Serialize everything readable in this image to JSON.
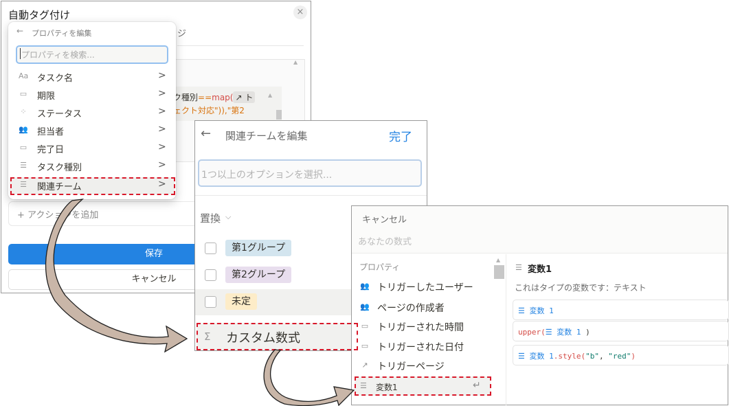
{
  "panel1": {
    "title": "自動タグ付け",
    "close_glyph": "×",
    "tab_partial": "ジ",
    "code_line1": {
      "prefix": "スク種別",
      "op": "==",
      "fn": "map(",
      "chip": "↗ ト"
    },
    "code_line2": "ジェクト対応\")),\"第2",
    "action_label": "+ アクションを追加",
    "save_label": "保存",
    "cancel_label": "キャンセル"
  },
  "dropdown": {
    "back_glyph": "←",
    "header": "プロパティを編集",
    "search_placeholder": "プロパティを検索...",
    "chevron": ">",
    "items": [
      {
        "icon": "Aa",
        "icon_name": "text-icon",
        "label": "タスク名"
      },
      {
        "icon": "▭",
        "icon_name": "calendar-icon",
        "label": "期限"
      },
      {
        "icon": "⁘",
        "icon_name": "status-icon",
        "label": "ステータス"
      },
      {
        "icon": "👥",
        "icon_name": "people-icon",
        "label": "担当者"
      },
      {
        "icon": "▭",
        "icon_name": "calendar-icon",
        "label": "完了日"
      },
      {
        "icon": "☰",
        "icon_name": "list-icon",
        "label": "タスク種別"
      },
      {
        "icon": "☰",
        "icon_name": "list-icon",
        "label": "関連チーム"
      }
    ]
  },
  "panel2": {
    "back_glyph": "←",
    "title": "関連チームを編集",
    "done_label": "完了",
    "input_placeholder": "1つ以上のオプションを選択...",
    "replace_label": "置換",
    "replace_chevron": "⌵",
    "options": [
      {
        "label": "第1グループ",
        "color": "#d3e5ef"
      },
      {
        "label": "第2グループ",
        "color": "#e8deee"
      },
      {
        "label": "未定",
        "color": "#fdecc8"
      }
    ],
    "formula_icon": "Σ",
    "formula_label": "カスタム数式"
  },
  "panel3": {
    "cancel_label": "キャンセル",
    "formula_placeholder": "あなたの数式",
    "properties_header": "プロパティ",
    "properties": [
      {
        "icon": "👥",
        "icon_name": "people-icon",
        "label": "トリガーしたユーザー"
      },
      {
        "icon": "👥",
        "icon_name": "people-icon",
        "label": "ページの作成者"
      },
      {
        "icon": "▭",
        "icon_name": "calendar-icon",
        "label": "トリガーされた時間"
      },
      {
        "icon": "▭",
        "icon_name": "calendar-icon",
        "label": "トリガーされた日付"
      },
      {
        "icon": "↗",
        "icon_name": "arrow-icon",
        "label": "トリガーページ"
      }
    ],
    "selected": {
      "icon": "☰",
      "label": "変数1",
      "enter_glyph": "↵"
    },
    "detail": {
      "icon": "☰",
      "title": "変数1",
      "description": "これはタイプの変数です：テキスト",
      "examples": [
        {
          "parts": [
            {
              "t": "var",
              "s": "☰ 変数 1"
            }
          ]
        },
        {
          "parts": [
            {
              "t": "fn",
              "s": "upper("
            },
            {
              "t": "var",
              "s": "☰ 変数 1"
            },
            {
              "t": "plain",
              "s": " )"
            }
          ]
        },
        {
          "parts": [
            {
              "t": "var",
              "s": "☰ 変数 1"
            },
            {
              "t": "fn",
              "s": ".style("
            },
            {
              "t": "str",
              "s": "\"b\""
            },
            {
              "t": "plain",
              "s": ", "
            },
            {
              "t": "str",
              "s": "\"red\""
            },
            {
              "t": "fn",
              "s": ")"
            }
          ]
        }
      ]
    }
  },
  "colors": {
    "accent": "#2383e2",
    "highlight": "#d8182a",
    "arrow_fill": "#c9b6a8"
  }
}
